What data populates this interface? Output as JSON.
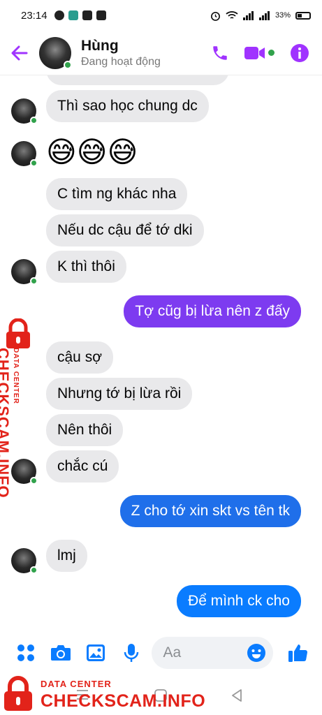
{
  "status_bar": {
    "time": "23:14",
    "battery": "33%",
    "app_icons": [
      "messenger-icon",
      "app-icon",
      "facebook-icon",
      "instagram-icon"
    ]
  },
  "header": {
    "name": "Hùng",
    "status": "Đang hoạt động",
    "accent_color": "#a033ff"
  },
  "messages": [
    {
      "dir": "in",
      "text": "Thì sao học chung dc"
    },
    {
      "dir": "in",
      "type": "emoji",
      "text": "😅😅😅"
    },
    {
      "dir": "in",
      "text": "C tìm ng khác nha"
    },
    {
      "dir": "in",
      "text": "Nếu dc cậu để tớ dki"
    },
    {
      "dir": "in",
      "text": "K thì thôi"
    },
    {
      "dir": "out",
      "text": "Tợ cũg bị lừa nên z đấy",
      "color": "#7d3bf0"
    },
    {
      "dir": "in",
      "text": "cậu sợ"
    },
    {
      "dir": "in",
      "text": "Nhưng tớ bị lừa rồi"
    },
    {
      "dir": "in",
      "text": "Nên thôi"
    },
    {
      "dir": "in",
      "text": "chắc cú"
    },
    {
      "dir": "out",
      "text": "Z cho tớ xin skt vs tên tk",
      "color": "#1f6fea"
    },
    {
      "dir": "in",
      "text": "lmj"
    },
    {
      "dir": "out",
      "text": "Để mình ck cho",
      "color": "#0a7cff"
    }
  ],
  "composer": {
    "placeholder": "Aa",
    "icon_color": "#0a7cff"
  },
  "watermark": {
    "label_small": "DATA CENTER",
    "label_big": "CHECKSCAM.INFO",
    "color": "#e2231a"
  }
}
